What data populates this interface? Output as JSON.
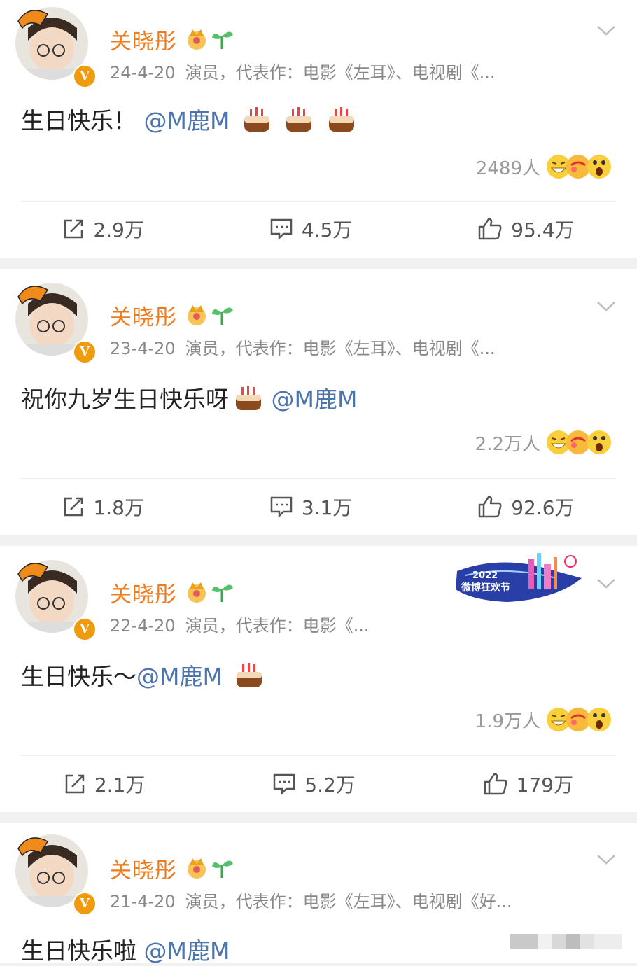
{
  "user": {
    "name": "关晓彤"
  },
  "posts": [
    {
      "date": "24-4-20",
      "bio": "演员，代表作：电影《左耳》、电视剧《...",
      "text": "生日快乐！",
      "mention": "@M鹿M",
      "cakes": 3,
      "reaction_count": "2489人",
      "share": "2.9万",
      "comment": "4.5万",
      "like": "95.4万"
    },
    {
      "date": "23-4-20",
      "bio": "演员，代表作：电影《左耳》、电视剧《...",
      "text": "祝你九岁生日快乐呀",
      "mention": "@M鹿M",
      "cakes": 1,
      "reaction_count": "2.2万人",
      "share": "1.8万",
      "comment": "3.1万",
      "like": "92.6万"
    },
    {
      "date": "22-4-20",
      "bio": "演员，代表作：电影《...",
      "text": "生日快乐～",
      "mention": "@M鹿M",
      "cakes": 1,
      "reaction_count": "1.9万人",
      "share": "2.1万",
      "comment": "5.2万",
      "like": "179万",
      "banner": {
        "year": "2022",
        "title": "微博狂欢节"
      }
    },
    {
      "date": "21-4-20",
      "bio": "演员，代表作：电影《左耳》、电视剧《好...",
      "text": "生日快乐啦",
      "mention": "@M鹿M"
    }
  ],
  "icons": {
    "chevron": "chevron-down-icon",
    "share": "share-icon",
    "comment": "comment-icon",
    "like": "thumbs-up-icon",
    "cake": "birthday-cake-emoji",
    "crown": "crown-badge-icon",
    "sprout": "sprout-badge-icon"
  },
  "colors": {
    "username": "#f07b1c",
    "mention": "#4c74ad",
    "meta": "#888888",
    "verified": "#f09a0e",
    "separator": "#f1f1f1"
  }
}
